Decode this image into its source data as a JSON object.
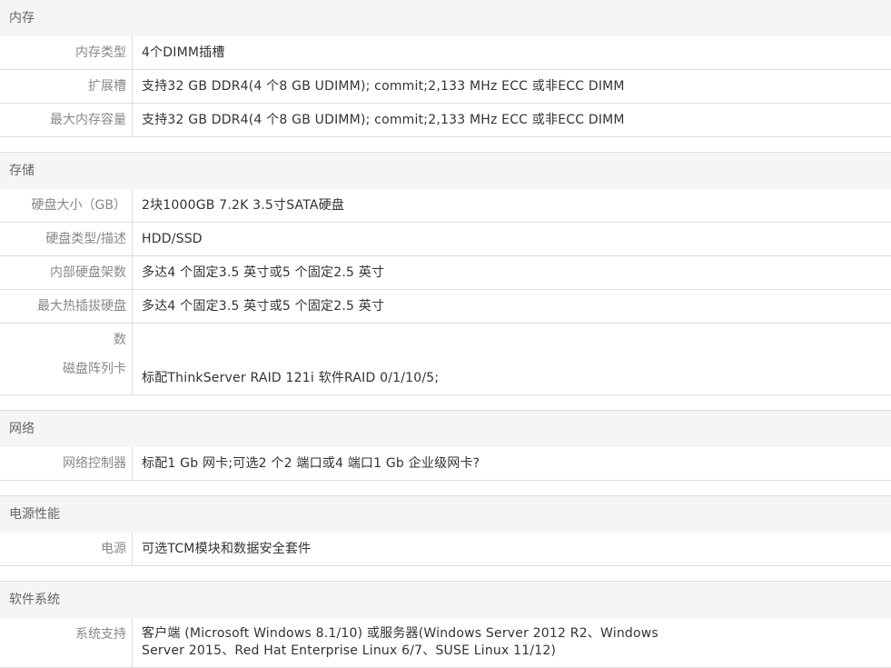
{
  "sections": [
    {
      "title": "内存",
      "rows": [
        {
          "label": "内存类型",
          "value": "4个DIMM插槽"
        },
        {
          "label": "扩展槽",
          "value": "支持32 GB DDR4(4 个8 GB UDIMM); commit;2,133 MHz ECC 或非ECC DIMM"
        },
        {
          "label": "最大内存容量",
          "value": "支持32 GB DDR4(4 个8 GB UDIMM); commit;2,133 MHz ECC 或非ECC DIMM"
        }
      ]
    },
    {
      "title": "存储",
      "rows": [
        {
          "label": "硬盘大小（GB）",
          "value": "2块1000GB 7.2K 3.5寸SATA硬盘"
        },
        {
          "label": "硬盘类型/描述",
          "value": "HDD/SSD"
        },
        {
          "label": "内部硬盘架数",
          "value": "多达4 个固定3.5 英寸或5 个固定2.5 英寸"
        },
        {
          "label": "最大热插拔硬盘",
          "value": "多达4 个固定3.5 英寸或5 个固定2.5 英寸"
        },
        {
          "label_line1": "数",
          "label_line2": "磁盘阵列卡",
          "value": "标配ThinkServer RAID 121i 软件RAID 0/1/10/5;"
        }
      ]
    },
    {
      "title": "网络",
      "rows": [
        {
          "label": "网络控制器",
          "value": "标配1 Gb 网卡;可选2 个2 端口或4 端口1 Gb 企业级网卡?"
        }
      ]
    },
    {
      "title": "电源性能",
      "rows": [
        {
          "label": "电源",
          "value": "可选TCM模块和数据安全套件"
        }
      ]
    },
    {
      "title": "软件系统",
      "rows": [
        {
          "label": "系统支持",
          "value": "客户端 (Microsoft Windows 8.1/10) 或服务器(Windows Server 2012 R2、Windows Server 2015、Red Hat Enterprise Linux 6/7、SUSE Linux 11/12)"
        }
      ]
    }
  ]
}
